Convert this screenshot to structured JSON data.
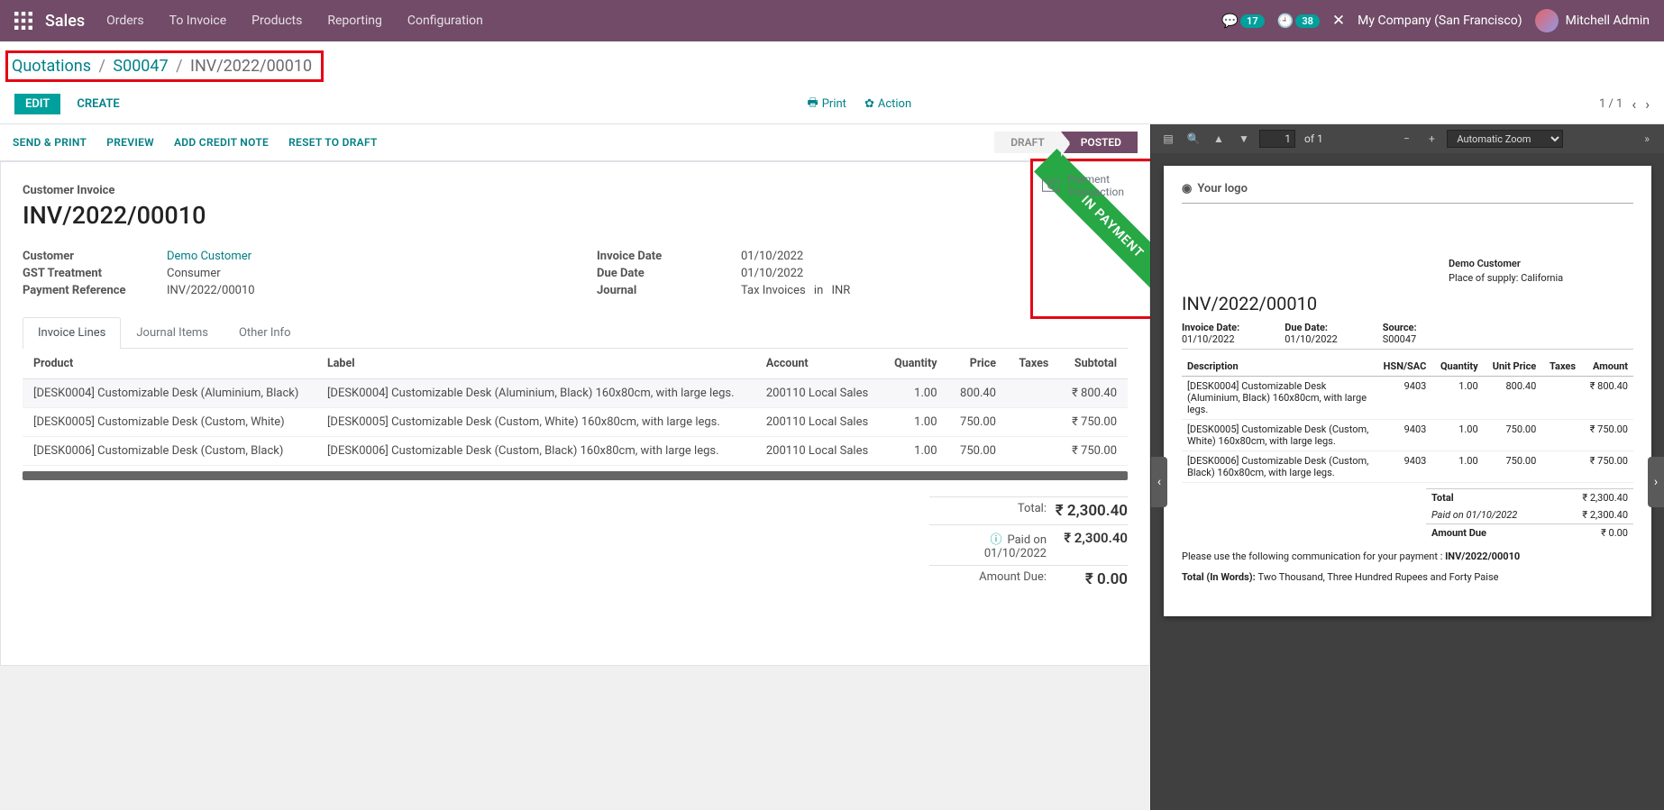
{
  "topnav": {
    "brand": "Sales",
    "menu": [
      "Orders",
      "To Invoice",
      "Products",
      "Reporting",
      "Configuration"
    ],
    "chat_badge": "17",
    "clock_badge": "38",
    "company": "My Company (San Francisco)",
    "user": "Mitchell Admin"
  },
  "breadcrumb": {
    "part1": "Quotations",
    "part2": "S00047",
    "current": "INV/2022/00010"
  },
  "control": {
    "edit": "EDIT",
    "create": "CREATE",
    "print": "Print",
    "action": "Action",
    "pager": "1 / 1"
  },
  "statusbar": {
    "send_print": "SEND & PRINT",
    "preview": "PREVIEW",
    "add_credit_note": "ADD CREDIT NOTE",
    "reset_to_draft": "RESET TO DRAFT",
    "stage_draft": "DRAFT",
    "stage_posted": "POSTED"
  },
  "form": {
    "payment_trans_l1": "Payment",
    "payment_trans_l2": "Transaction",
    "ribbon": "IN PAYMENT",
    "title_label": "Customer Invoice",
    "title": "INV/2022/00010",
    "labels": {
      "customer": "Customer",
      "gst_treatment": "GST Treatment",
      "payment_reference": "Payment Reference",
      "invoice_date": "Invoice Date",
      "due_date": "Due Date",
      "journal": "Journal"
    },
    "values": {
      "customer": "Demo Customer",
      "gst_treatment": "Consumer",
      "payment_reference": "INV/2022/00010",
      "invoice_date": "01/10/2022",
      "due_date": "01/10/2022",
      "journal": "Tax Invoices",
      "journal_in": "in",
      "journal_currency": "INR"
    }
  },
  "tabs": {
    "t1": "Invoice Lines",
    "t2": "Journal Items",
    "t3": "Other Info"
  },
  "lines": {
    "headers": {
      "product": "Product",
      "label": "Label",
      "account": "Account",
      "quantity": "Quantity",
      "price": "Price",
      "taxes": "Taxes",
      "subtotal": "Subtotal"
    },
    "rows": [
      {
        "product": "[DESK0004] Customizable Desk (Aluminium, Black)",
        "label": "[DESK0004] Customizable Desk (Aluminium, Black) 160x80cm, with large legs.",
        "account": "200110 Local Sales",
        "quantity": "1.00",
        "price": "800.40",
        "taxes": "",
        "subtotal": "₹ 800.40"
      },
      {
        "product": "[DESK0005] Customizable Desk (Custom, White)",
        "label": "[DESK0005] Customizable Desk (Custom, White) 160x80cm, with large legs.",
        "account": "200110 Local Sales",
        "quantity": "1.00",
        "price": "750.00",
        "taxes": "",
        "subtotal": "₹ 750.00"
      },
      {
        "product": "[DESK0006] Customizable Desk (Custom, Black)",
        "label": "[DESK0006] Customizable Desk (Custom, Black) 160x80cm, with large legs.",
        "account": "200110 Local Sales",
        "quantity": "1.00",
        "price": "750.00",
        "taxes": "",
        "subtotal": "₹ 750.00"
      }
    ]
  },
  "totals": {
    "total_label": "Total:",
    "total_val": "₹ 2,300.40",
    "paid_label": "Paid on 01/10/2022",
    "paid_val": "₹ 2,300.40",
    "due_label": "Amount Due:",
    "due_val": "₹ 0.00"
  },
  "pdfbar": {
    "page_input": "1",
    "of": "of 1",
    "zoom": "Automatic Zoom"
  },
  "pdf": {
    "logo": "Your logo",
    "customer_name": "Demo Customer",
    "supply": "Place of supply: California",
    "inv_title": "INV/2022/00010",
    "meta": {
      "invoice_date_l": "Invoice Date:",
      "invoice_date_v": "01/10/2022",
      "due_date_l": "Due Date:",
      "due_date_v": "01/10/2022",
      "source_l": "Source:",
      "source_v": "S00047"
    },
    "headers": {
      "desc": "Description",
      "hsn": "HSN/SAC",
      "qty": "Quantity",
      "price": "Unit Price",
      "taxes": "Taxes",
      "amount": "Amount"
    },
    "rows": [
      {
        "desc": "[DESK0004] Customizable Desk (Aluminium, Black) 160x80cm, with large legs.",
        "hsn": "9403",
        "qty": "1.00",
        "price": "800.40",
        "amount": "₹ 800.40"
      },
      {
        "desc": "[DESK0005] Customizable Desk (Custom, White) 160x80cm, with large legs.",
        "hsn": "9403",
        "qty": "1.00",
        "price": "750.00",
        "amount": "₹ 750.00"
      },
      {
        "desc": "[DESK0006] Customizable Desk (Custom, Black) 160x80cm, with large legs.",
        "hsn": "9403",
        "qty": "1.00",
        "price": "750.00",
        "amount": "₹ 750.00"
      }
    ],
    "total_l": "Total",
    "total_v": "₹ 2,300.40",
    "paid_l": "Paid on 01/10/2022",
    "paid_v": "₹ 2,300.40",
    "due_l": "Amount Due",
    "due_v": "₹ 0.00",
    "note_prefix": "Please use the following communication for your payment : ",
    "note_ref": "INV/2022/00010",
    "words_l": "Total (In Words): ",
    "words_v": "Two Thousand, Three Hundred Rupees and Forty Paise"
  }
}
